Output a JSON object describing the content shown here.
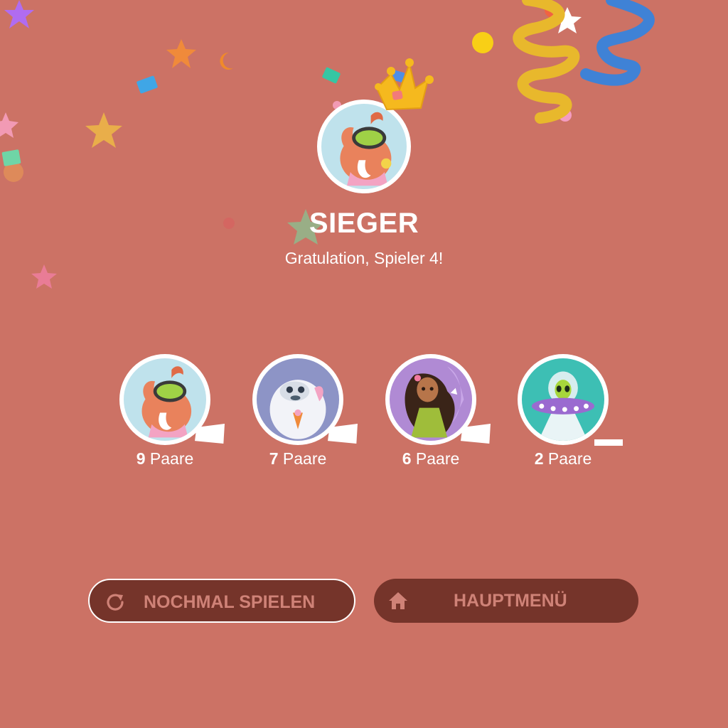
{
  "winner": {
    "title": "SIEGER",
    "message": "Gratulation, Spieler 4!"
  },
  "players": [
    {
      "pairs": "9",
      "unit": "Paare",
      "avatar": "mammoth-avatar"
    },
    {
      "pairs": "7",
      "unit": "Paare",
      "avatar": "yeti-avatar"
    },
    {
      "pairs": "6",
      "unit": "Paare",
      "avatar": "girl-avatar"
    },
    {
      "pairs": "2",
      "unit": "Paare",
      "avatar": "alien-avatar"
    }
  ],
  "buttons": {
    "replay": {
      "label": "NOCHMAL SPIELEN",
      "icon": "replay-icon"
    },
    "home": {
      "label": "HAUPTMENÜ",
      "icon": "home-icon"
    }
  },
  "colors": {
    "background": "#cc7265",
    "button": "#75342a",
    "button_text": "#cf8277",
    "text": "#ffffff",
    "crown": "#f5b91e"
  }
}
